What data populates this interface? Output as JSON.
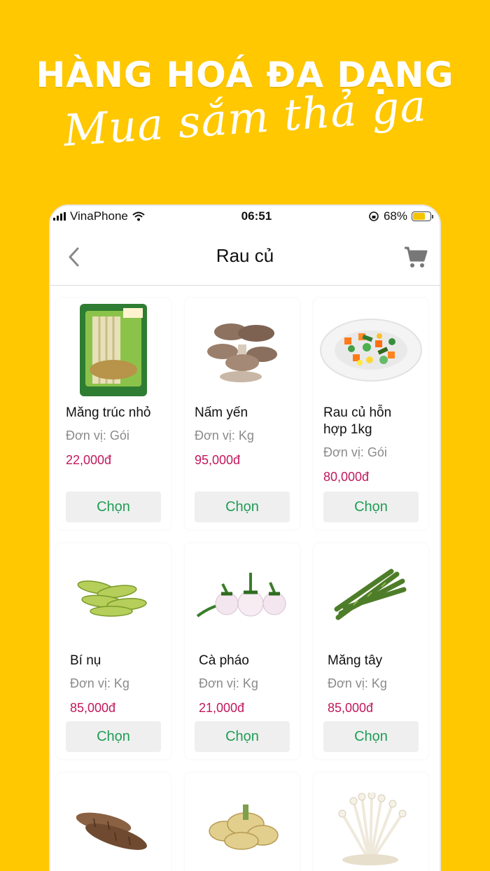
{
  "banner": {
    "headline": "HÀNG HOÁ ĐA DẠNG",
    "tagline": "Mua sắm thả ga"
  },
  "status_bar": {
    "carrier": "VinaPhone",
    "time": "06:51",
    "battery": "68%"
  },
  "nav": {
    "title": "Rau củ"
  },
  "products": [
    {
      "name": "Măng trúc nhỏ",
      "unit": "Đơn vị: Gói",
      "price": "22,000đ",
      "button": "Chọn",
      "icon": "bamboo-shoot-package"
    },
    {
      "name": "Nấm yến",
      "unit": "Đơn vị: Kg",
      "price": "95,000đ",
      "button": "Chọn",
      "icon": "oyster-mushroom"
    },
    {
      "name": "Rau củ hỗn hợp 1kg",
      "unit": "Đơn vị: Gói",
      "price": "80,000đ",
      "button": "Chọn",
      "icon": "mixed-vegetables"
    },
    {
      "name": "Bí nụ",
      "unit": "Đơn vị: Kg",
      "price": "85,000đ",
      "button": "Chọn",
      "icon": "squash-buds"
    },
    {
      "name": "Cà pháo",
      "unit": "Đơn vị: Kg",
      "price": "21,000đ",
      "button": "Chọn",
      "icon": "white-eggplant"
    },
    {
      "name": "Măng tây",
      "unit": "Đơn vị: Kg",
      "price": "85,000đ",
      "button": "Chọn",
      "icon": "asparagus"
    },
    {
      "icon": "taro-root"
    },
    {
      "icon": "galangal"
    },
    {
      "icon": "enoki-mushroom"
    }
  ],
  "colors": {
    "background": "#FFC800",
    "price": "#c2185b",
    "button_text": "#1f9d55"
  }
}
